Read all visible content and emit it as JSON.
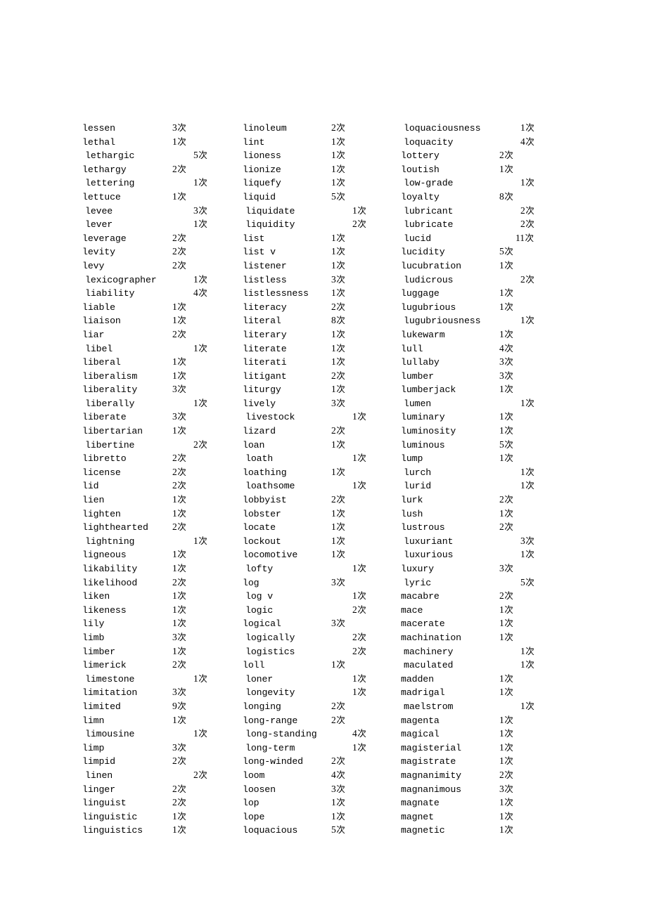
{
  "document": {
    "type": "vocabulary-frequency-list",
    "count_unit": "次",
    "column_count": 3
  },
  "columns": [
    {
      "name": "column-1",
      "entries": [
        {
          "word": "lessen",
          "count": "3",
          "unit": "次",
          "shift": false
        },
        {
          "word": "lethal",
          "count": "1",
          "unit": "次",
          "shift": false
        },
        {
          "word": "lethargic",
          "count": "5",
          "unit": "次",
          "shift": true
        },
        {
          "word": "lethargy",
          "count": "2",
          "unit": "次",
          "shift": false
        },
        {
          "word": "lettering",
          "count": "1",
          "unit": "次",
          "shift": true
        },
        {
          "word": "lettuce",
          "count": "1",
          "unit": "次",
          "shift": false
        },
        {
          "word": "levee",
          "count": "3",
          "unit": "次",
          "shift": true
        },
        {
          "word": "lever",
          "count": "1",
          "unit": "次",
          "shift": true
        },
        {
          "word": "leverage",
          "count": "2",
          "unit": "次",
          "shift": false
        },
        {
          "word": "levity",
          "count": "2",
          "unit": "次",
          "shift": false
        },
        {
          "word": "levy",
          "count": "2",
          "unit": "次",
          "shift": false
        },
        {
          "word": "lexicographer",
          "count": "1",
          "unit": "次",
          "shift": true
        },
        {
          "word": "liability",
          "count": "4",
          "unit": "次",
          "shift": true
        },
        {
          "word": "liable",
          "count": "1",
          "unit": "次",
          "shift": false
        },
        {
          "word": "liaison",
          "count": "1",
          "unit": "次",
          "shift": false
        },
        {
          "word": "liar",
          "count": "2",
          "unit": "次",
          "shift": false
        },
        {
          "word": "libel",
          "count": "1",
          "unit": "次",
          "shift": true
        },
        {
          "word": "liberal",
          "count": "1",
          "unit": "次",
          "shift": false
        },
        {
          "word": "liberalism",
          "count": "1",
          "unit": "次",
          "shift": false
        },
        {
          "word": "liberality",
          "count": "3",
          "unit": "次",
          "shift": false
        },
        {
          "word": "liberally",
          "count": "1",
          "unit": "次",
          "shift": true
        },
        {
          "word": "liberate",
          "count": "3",
          "unit": "次",
          "shift": false
        },
        {
          "word": "libertarian",
          "count": "1",
          "unit": "次",
          "shift": false
        },
        {
          "word": "libertine",
          "count": "2",
          "unit": "次",
          "shift": true
        },
        {
          "word": "libretto",
          "count": "2",
          "unit": "次",
          "shift": false
        },
        {
          "word": "license",
          "count": "2",
          "unit": "次",
          "shift": false
        },
        {
          "word": "lid",
          "count": "2",
          "unit": "次",
          "shift": false
        },
        {
          "word": "lien",
          "count": "1",
          "unit": "次",
          "shift": false
        },
        {
          "word": "lighten",
          "count": "1",
          "unit": "次",
          "shift": false
        },
        {
          "word": "lighthearted",
          "count": "2",
          "unit": "次",
          "shift": false
        },
        {
          "word": "lightning",
          "count": "1",
          "unit": "次",
          "shift": true
        },
        {
          "word": "ligneous",
          "count": "1",
          "unit": "次",
          "shift": false
        },
        {
          "word": "likability",
          "count": "1",
          "unit": "次",
          "shift": false
        },
        {
          "word": "likelihood",
          "count": "2",
          "unit": "次",
          "shift": false
        },
        {
          "word": "liken",
          "count": "1",
          "unit": "次",
          "shift": false
        },
        {
          "word": "likeness",
          "count": "1",
          "unit": "次",
          "shift": false
        },
        {
          "word": "lily",
          "count": "1",
          "unit": "次",
          "shift": false
        },
        {
          "word": "limb",
          "count": "3",
          "unit": "次",
          "shift": false
        },
        {
          "word": "limber",
          "count": "1",
          "unit": "次",
          "shift": false
        },
        {
          "word": "limerick",
          "count": "2",
          "unit": "次",
          "shift": false
        },
        {
          "word": "limestone",
          "count": "1",
          "unit": "次",
          "shift": true
        },
        {
          "word": "limitation",
          "count": "3",
          "unit": "次",
          "shift": false
        },
        {
          "word": "limited",
          "count": "9",
          "unit": "次",
          "shift": false
        },
        {
          "word": "limn",
          "count": "1",
          "unit": "次",
          "shift": false
        },
        {
          "word": "limousine",
          "count": "1",
          "unit": "次",
          "shift": true
        },
        {
          "word": "limp",
          "count": "3",
          "unit": "次",
          "shift": false
        },
        {
          "word": "limpid",
          "count": "2",
          "unit": "次",
          "shift": false
        },
        {
          "word": "linen",
          "count": "2",
          "unit": "次",
          "shift": true
        },
        {
          "word": "linger",
          "count": "2",
          "unit": "次",
          "shift": false
        },
        {
          "word": "linguist",
          "count": "2",
          "unit": "次",
          "shift": false
        },
        {
          "word": "linguistic",
          "count": "1",
          "unit": "次",
          "shift": false
        },
        {
          "word": "linguistics",
          "count": "1",
          "unit": "次",
          "shift": false
        }
      ]
    },
    {
      "name": "column-2",
      "entries": [
        {
          "word": "linoleum",
          "count": "2",
          "unit": "次",
          "shift": false
        },
        {
          "word": "lint",
          "count": "1",
          "unit": "次",
          "shift": false
        },
        {
          "word": "lioness",
          "count": "1",
          "unit": "次",
          "shift": false
        },
        {
          "word": "lionize",
          "count": "1",
          "unit": "次",
          "shift": false
        },
        {
          "word": "liquefy",
          "count": "1",
          "unit": "次",
          "shift": false
        },
        {
          "word": "liquid",
          "count": "5",
          "unit": "次",
          "shift": false
        },
        {
          "word": "liquidate",
          "count": "1",
          "unit": "次",
          "shift": true
        },
        {
          "word": "liquidity",
          "count": "2",
          "unit": "次",
          "shift": true
        },
        {
          "word": "list",
          "count": "1",
          "unit": "次",
          "shift": false
        },
        {
          "word": "list v",
          "count": "1",
          "unit": "次",
          "shift": false
        },
        {
          "word": "listener",
          "count": "1",
          "unit": "次",
          "shift": false
        },
        {
          "word": "listless",
          "count": "3",
          "unit": "次",
          "shift": false
        },
        {
          "word": "listlessness",
          "count": "1",
          "unit": "次",
          "shift": false
        },
        {
          "word": "literacy",
          "count": "2",
          "unit": "次",
          "shift": false
        },
        {
          "word": "literal",
          "count": "8",
          "unit": "次",
          "shift": false
        },
        {
          "word": "literary",
          "count": "1",
          "unit": "次",
          "shift": false
        },
        {
          "word": "literate",
          "count": "1",
          "unit": "次",
          "shift": false
        },
        {
          "word": "literati",
          "count": "1",
          "unit": "次",
          "shift": false
        },
        {
          "word": "litigant",
          "count": "2",
          "unit": "次",
          "shift": false
        },
        {
          "word": "liturgy",
          "count": "1",
          "unit": "次",
          "shift": false
        },
        {
          "word": "lively",
          "count": "3",
          "unit": "次",
          "shift": false
        },
        {
          "word": "livestock",
          "count": "1",
          "unit": "次",
          "shift": true
        },
        {
          "word": "lizard",
          "count": "2",
          "unit": "次",
          "shift": false
        },
        {
          "word": "loan",
          "count": "1",
          "unit": "次",
          "shift": false
        },
        {
          "word": "loath",
          "count": "1",
          "unit": "次",
          "shift": true
        },
        {
          "word": "loathing",
          "count": "1",
          "unit": "次",
          "shift": false
        },
        {
          "word": "loathsome",
          "count": "1",
          "unit": "次",
          "shift": true
        },
        {
          "word": "lobbyist",
          "count": "2",
          "unit": "次",
          "shift": false
        },
        {
          "word": "lobster",
          "count": "1",
          "unit": "次",
          "shift": false
        },
        {
          "word": "locate",
          "count": "1",
          "unit": "次",
          "shift": false
        },
        {
          "word": "lockout",
          "count": "1",
          "unit": "次",
          "shift": false
        },
        {
          "word": "locomotive",
          "count": "1",
          "unit": "次",
          "shift": false
        },
        {
          "word": "lofty",
          "count": "1",
          "unit": "次",
          "shift": true
        },
        {
          "word": "log",
          "count": "3",
          "unit": "次",
          "shift": false
        },
        {
          "word": "log v",
          "count": "1",
          "unit": "次",
          "shift": true
        },
        {
          "word": "logic",
          "count": "2",
          "unit": "次",
          "shift": true
        },
        {
          "word": "logical",
          "count": "3",
          "unit": "次",
          "shift": false
        },
        {
          "word": "logically",
          "count": "2",
          "unit": "次",
          "shift": true
        },
        {
          "word": "logistics",
          "count": "2",
          "unit": "次",
          "shift": true
        },
        {
          "word": "loll",
          "count": "1",
          "unit": "次",
          "shift": false
        },
        {
          "word": "loner",
          "count": "1",
          "unit": "次",
          "shift": true
        },
        {
          "word": "longevity",
          "count": "1",
          "unit": "次",
          "shift": true
        },
        {
          "word": "longing",
          "count": "2",
          "unit": "次",
          "shift": false
        },
        {
          "word": "long-range",
          "count": "2",
          "unit": "次",
          "shift": false
        },
        {
          "word": "long-standing",
          "count": "4",
          "unit": "次",
          "shift": true
        },
        {
          "word": "long-term",
          "count": "1",
          "unit": "次",
          "shift": true
        },
        {
          "word": "long-winded",
          "count": "2",
          "unit": "次",
          "shift": false
        },
        {
          "word": "loom",
          "count": "4",
          "unit": "次",
          "shift": false
        },
        {
          "word": "loosen",
          "count": "3",
          "unit": "次",
          "shift": false
        },
        {
          "word": "lop",
          "count": "1",
          "unit": "次",
          "shift": false
        },
        {
          "word": "lope",
          "count": "1",
          "unit": "次",
          "shift": false
        },
        {
          "word": "loquacious",
          "count": "5",
          "unit": "次",
          "shift": false
        }
      ]
    },
    {
      "name": "column-3",
      "entries": [
        {
          "word": "loquaciousness",
          "count": "1",
          "unit": "次",
          "shift": true
        },
        {
          "word": "loquacity",
          "count": "4",
          "unit": "次",
          "shift": true
        },
        {
          "word": "lottery",
          "count": "2",
          "unit": "次",
          "shift": false
        },
        {
          "word": "loutish",
          "count": "1",
          "unit": "次",
          "shift": false
        },
        {
          "word": "low-grade",
          "count": "1",
          "unit": "次",
          "shift": true
        },
        {
          "word": "loyalty",
          "count": "8",
          "unit": "次",
          "shift": false
        },
        {
          "word": "lubricant",
          "count": "2",
          "unit": "次",
          "shift": true
        },
        {
          "word": "lubricate",
          "count": "2",
          "unit": "次",
          "shift": true
        },
        {
          "word": "lucid",
          "count": "11",
          "unit": "次",
          "shift": true
        },
        {
          "word": "lucidity",
          "count": "5",
          "unit": "次",
          "shift": false
        },
        {
          "word": "lucubration",
          "count": "1",
          "unit": "次",
          "shift": false
        },
        {
          "word": "ludicrous",
          "count": "2",
          "unit": "次",
          "shift": true
        },
        {
          "word": "luggage",
          "count": "1",
          "unit": "次",
          "shift": false
        },
        {
          "word": "lugubrious",
          "count": "1",
          "unit": "次",
          "shift": false
        },
        {
          "word": "lugubriousness",
          "count": "1",
          "unit": "次",
          "shift": true
        },
        {
          "word": "lukewarm",
          "count": "1",
          "unit": "次",
          "shift": false
        },
        {
          "word": "lull",
          "count": "4",
          "unit": "次",
          "shift": false
        },
        {
          "word": "lullaby",
          "count": "3",
          "unit": "次",
          "shift": false
        },
        {
          "word": "lumber",
          "count": "3",
          "unit": "次",
          "shift": false
        },
        {
          "word": "lumberjack",
          "count": "1",
          "unit": "次",
          "shift": false
        },
        {
          "word": "lumen",
          "count": "1",
          "unit": "次",
          "shift": true
        },
        {
          "word": "luminary",
          "count": "1",
          "unit": "次",
          "shift": false
        },
        {
          "word": "luminosity",
          "count": "1",
          "unit": "次",
          "shift": false
        },
        {
          "word": "luminous",
          "count": "5",
          "unit": "次",
          "shift": false
        },
        {
          "word": "lump",
          "count": "1",
          "unit": "次",
          "shift": false
        },
        {
          "word": "lurch",
          "count": "1",
          "unit": "次",
          "shift": true
        },
        {
          "word": "lurid",
          "count": "1",
          "unit": "次",
          "shift": true
        },
        {
          "word": "lurk",
          "count": "2",
          "unit": "次",
          "shift": false
        },
        {
          "word": "lush",
          "count": "1",
          "unit": "次",
          "shift": false
        },
        {
          "word": "lustrous",
          "count": "2",
          "unit": "次",
          "shift": false
        },
        {
          "word": "luxuriant",
          "count": "3",
          "unit": "次",
          "shift": true
        },
        {
          "word": "luxurious",
          "count": "1",
          "unit": "次",
          "shift": true
        },
        {
          "word": "luxury",
          "count": "3",
          "unit": "次",
          "shift": false
        },
        {
          "word": "lyric",
          "count": "5",
          "unit": "次",
          "shift": true
        },
        {
          "word": "macabre",
          "count": "2",
          "unit": "次",
          "shift": false
        },
        {
          "word": "mace",
          "count": "1",
          "unit": "次",
          "shift": false
        },
        {
          "word": "macerate",
          "count": "1",
          "unit": "次",
          "shift": false
        },
        {
          "word": "machination",
          "count": "1",
          "unit": "次",
          "shift": false
        },
        {
          "word": "machinery",
          "count": "1",
          "unit": "次",
          "shift": true
        },
        {
          "word": "maculated",
          "count": "1",
          "unit": "次",
          "shift": true
        },
        {
          "word": "madden",
          "count": "1",
          "unit": "次",
          "shift": false
        },
        {
          "word": "madrigal",
          "count": "1",
          "unit": "次",
          "shift": false
        },
        {
          "word": "maelstrom",
          "count": "1",
          "unit": "次",
          "shift": true
        },
        {
          "word": "magenta",
          "count": "1",
          "unit": "次",
          "shift": false
        },
        {
          "word": "magical",
          "count": "1",
          "unit": "次",
          "shift": false
        },
        {
          "word": "magisterial",
          "count": "1",
          "unit": "次",
          "shift": false
        },
        {
          "word": "magistrate",
          "count": "1",
          "unit": "次",
          "shift": false
        },
        {
          "word": "magnanimity",
          "count": "2",
          "unit": "次",
          "shift": false
        },
        {
          "word": "magnanimous",
          "count": "3",
          "unit": "次",
          "shift": false
        },
        {
          "word": "magnate",
          "count": "1",
          "unit": "次",
          "shift": false
        },
        {
          "word": "magnet",
          "count": "1",
          "unit": "次",
          "shift": false
        },
        {
          "word": "magnetic",
          "count": "1",
          "unit": "次",
          "shift": false
        }
      ]
    }
  ]
}
